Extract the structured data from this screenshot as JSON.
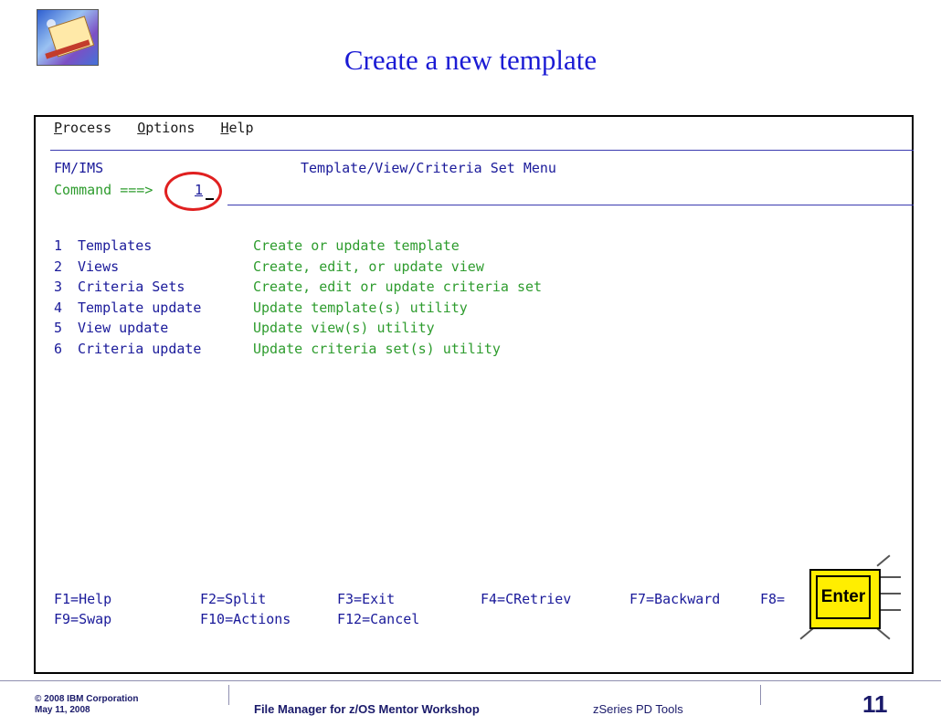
{
  "slide": {
    "title": "Create a new template"
  },
  "terminal": {
    "menubar": [
      {
        "accel": "P",
        "rest": "rocess"
      },
      {
        "accel": "O",
        "rest": "ptions"
      },
      {
        "accel": "H",
        "rest": "elp"
      }
    ],
    "panel_id": "FM/IMS",
    "panel_title": "Template/View/Criteria Set Menu",
    "command_label": "Command ===>",
    "command_value": "1",
    "options": [
      {
        "num": "1",
        "name": "Templates",
        "desc": "Create or update template"
      },
      {
        "num": "2",
        "name": "Views",
        "desc": "Create, edit, or update view"
      },
      {
        "num": "3",
        "name": "Criteria Sets",
        "desc": "Create, edit or update criteria set"
      },
      {
        "num": "4",
        "name": "Template update",
        "desc": "Update template(s) utility"
      },
      {
        "num": "5",
        "name": "View update",
        "desc": "Update view(s) utility"
      },
      {
        "num": "6",
        "name": "Criteria update",
        "desc": "Update criteria set(s) utility"
      }
    ],
    "fkeys_row1": [
      "F1=Help",
      "F2=Split",
      "F3=Exit",
      "F4=CRetriev",
      "F7=Backward",
      "F8="
    ],
    "fkeys_row2": [
      "F9=Swap",
      "F10=Actions",
      "F12=Cancel"
    ]
  },
  "enter_key": {
    "label": "Enter"
  },
  "footer": {
    "copyright": "© 2008 IBM Corporation",
    "date": "May 11, 2008",
    "course": "File Manager for z/OS Mentor Workshop",
    "tools": "zSeries PD Tools",
    "page": "11"
  },
  "colors": {
    "title": "#1b1bd4",
    "terminal_text": "#1a1a9a",
    "terminal_green": "#2e9c2e",
    "highlight": "#e02020",
    "enter_key": "#ffee00"
  }
}
